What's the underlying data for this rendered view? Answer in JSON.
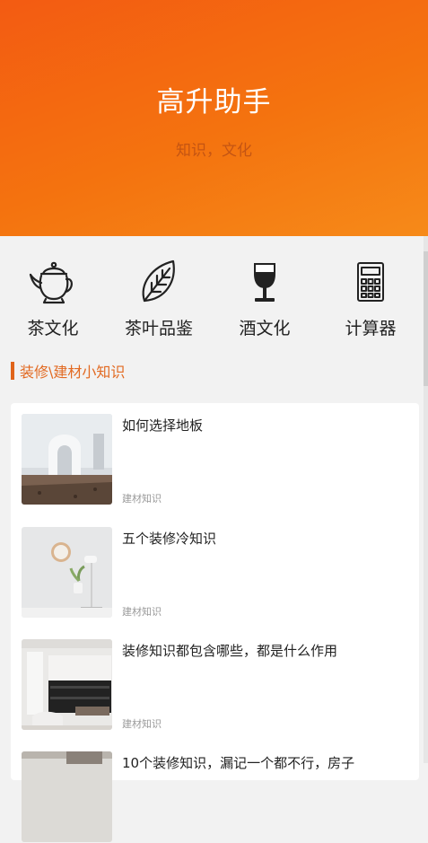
{
  "header": {
    "title": "高升助手",
    "subtitle": "知识，文化"
  },
  "nav": [
    {
      "label": "茶文化",
      "icon": "teapot-icon"
    },
    {
      "label": "茶叶品鉴",
      "icon": "leaf-icon"
    },
    {
      "label": "酒文化",
      "icon": "wine-glass-icon"
    },
    {
      "label": "计算器",
      "icon": "calculator-icon"
    }
  ],
  "section": {
    "title": "装修\\建材小知识"
  },
  "articles": [
    {
      "title": "如何选择地板",
      "tag": "建材知识"
    },
    {
      "title": "五个装修冷知识",
      "tag": "建材知识"
    },
    {
      "title": "装修知识都包含哪些，都是什么作用",
      "tag": "建材知识"
    },
    {
      "title": "10个装修知识，漏记一个都不行，房子",
      "tag": ""
    }
  ],
  "colors": {
    "header_gradient_start": "#f35b12",
    "header_gradient_end": "#f68a19",
    "accent": "#e0641a"
  }
}
